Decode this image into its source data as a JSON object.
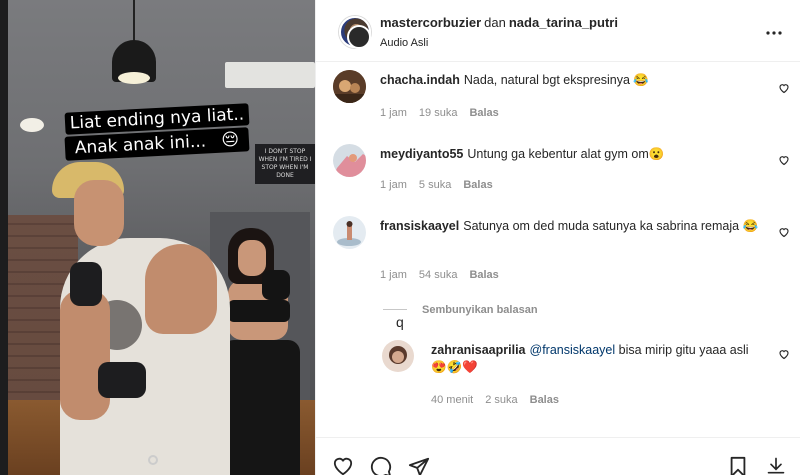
{
  "video": {
    "caption_line1": "Liat ending nya liat..",
    "caption_line2": "Anak anak ini...",
    "caption_emoji": "😔",
    "sign_text": "I DON'T STOP WHEN I'M TIRED I STOP WHEN I'M DONE"
  },
  "header": {
    "user1": "mastercorbuzier",
    "separator": "dan",
    "user2": "nada_tarina_putri",
    "audio": "Audio Asli",
    "more_icon": "more-horizontal-icon"
  },
  "comments": [
    {
      "user": "chacha.indah",
      "text": "Nada, natural bgt ekspresinya 😂",
      "time": "1 jam",
      "likes": "19 suka",
      "reply_label": "Balas",
      "avatar_color": "#b49070"
    },
    {
      "user": "meydiyanto55",
      "text": "Untung ga kebentur alat gym om😮",
      "time": "1 jam",
      "likes": "5 suka",
      "reply_label": "Balas",
      "avatar_color": "#c8d3dc"
    },
    {
      "user": "fransiskaayel",
      "text": "Satunya om ded muda satunya ka sabrina remaja 😂",
      "time": "1 jam",
      "likes": "54 suka",
      "reply_label": "Balas",
      "avatar_color": "#dfe7ee"
    }
  ],
  "thread": {
    "hide_replies": "Sembunyikan balasan",
    "stray_char": "q"
  },
  "reply": {
    "user": "zahranisaaprilia",
    "mention": "@fransiskaayel",
    "text": " bisa mirip gitu yaaa asli",
    "emojis": "😍🤣❤️",
    "time": "40 menit",
    "likes": "2 suka",
    "reply_label": "Balas",
    "avatar_color": "#caa48e"
  },
  "actions": {
    "like_icon": "heart-icon",
    "comment_icon": "comment-icon",
    "share_icon": "send-icon",
    "save_icon": "bookmark-icon",
    "download_icon": "download-icon"
  }
}
